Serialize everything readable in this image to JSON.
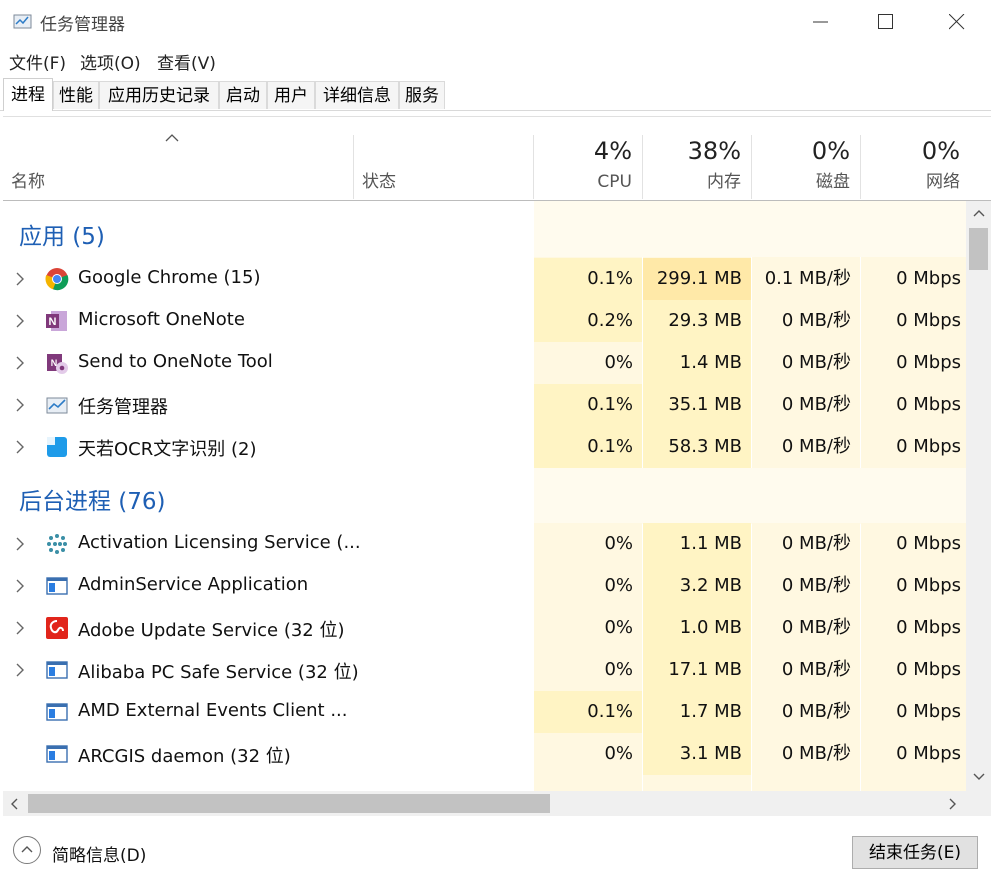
{
  "window": {
    "title": "任务管理器"
  },
  "menu": [
    "文件(F)",
    "选项(O)",
    "查看(V)"
  ],
  "tabs": [
    "进程",
    "性能",
    "应用历史记录",
    "启动",
    "用户",
    "详细信息",
    "服务"
  ],
  "columns": {
    "name": "名称",
    "status": "状态",
    "cpu": {
      "pct": "4%",
      "label": "CPU"
    },
    "memory": {
      "pct": "38%",
      "label": "内存"
    },
    "disk": {
      "pct": "0%",
      "label": "磁盘"
    },
    "network": {
      "pct": "0%",
      "label": "网络"
    }
  },
  "groups": [
    {
      "title": "应用 (5)",
      "rows": [
        {
          "icon": "chrome-icon",
          "name": "Google Chrome (15)",
          "cpu": "0.1%",
          "mem": "299.1 MB",
          "disk": "0.1 MB/秒",
          "net": "0 Mbps",
          "expandable": true
        },
        {
          "icon": "onenote-icon",
          "name": "Microsoft OneNote",
          "cpu": "0.2%",
          "mem": "29.3 MB",
          "disk": "0 MB/秒",
          "net": "0 Mbps",
          "expandable": true
        },
        {
          "icon": "send-to-onenote-icon",
          "name": "Send to OneNote Tool",
          "cpu": "0%",
          "mem": "1.4 MB",
          "disk": "0 MB/秒",
          "net": "0 Mbps",
          "expandable": true
        },
        {
          "icon": "task-manager-icon",
          "name": "任务管理器",
          "cpu": "0.1%",
          "mem": "35.1 MB",
          "disk": "0 MB/秒",
          "net": "0 Mbps",
          "expandable": true
        },
        {
          "icon": "ocr-icon",
          "name": "天若OCR文字识别 (2)",
          "cpu": "0.1%",
          "mem": "58.3 MB",
          "disk": "0 MB/秒",
          "net": "0 Mbps",
          "expandable": true
        }
      ]
    },
    {
      "title": "后台进程 (76)",
      "rows": [
        {
          "icon": "licensing-icon",
          "name": "Activation Licensing Service (...",
          "cpu": "0%",
          "mem": "1.1 MB",
          "disk": "0 MB/秒",
          "net": "0 Mbps",
          "expandable": true
        },
        {
          "icon": "service-window-icon",
          "name": "AdminService Application",
          "cpu": "0%",
          "mem": "3.2 MB",
          "disk": "0 MB/秒",
          "net": "0 Mbps",
          "expandable": true
        },
        {
          "icon": "adobe-icon",
          "name": "Adobe Update Service (32 位)",
          "cpu": "0%",
          "mem": "1.0 MB",
          "disk": "0 MB/秒",
          "net": "0 Mbps",
          "expandable": true
        },
        {
          "icon": "service-window-icon",
          "name": "Alibaba PC Safe Service (32 位)",
          "cpu": "0%",
          "mem": "17.1 MB",
          "disk": "0 MB/秒",
          "net": "0 Mbps",
          "expandable": true
        },
        {
          "icon": "service-window-icon",
          "name": "AMD External Events Client ...",
          "cpu": "0.1%",
          "mem": "1.7 MB",
          "disk": "0 MB/秒",
          "net": "0 Mbps",
          "expandable": false
        },
        {
          "icon": "service-window-icon",
          "name": "ARCGIS daemon (32 位)",
          "cpu": "0%",
          "mem": "3.1 MB",
          "disk": "0 MB/秒",
          "net": "0 Mbps",
          "expandable": false
        }
      ]
    }
  ],
  "footer": {
    "fewer_details": "简略信息(D)",
    "end_task": "结束任务(E)"
  },
  "colors": {
    "heat_light": "#fff8e1",
    "heat_mid": "#fff4c4",
    "heat_strong": "#ffe9a8",
    "group_title": "#1e5fb4"
  }
}
